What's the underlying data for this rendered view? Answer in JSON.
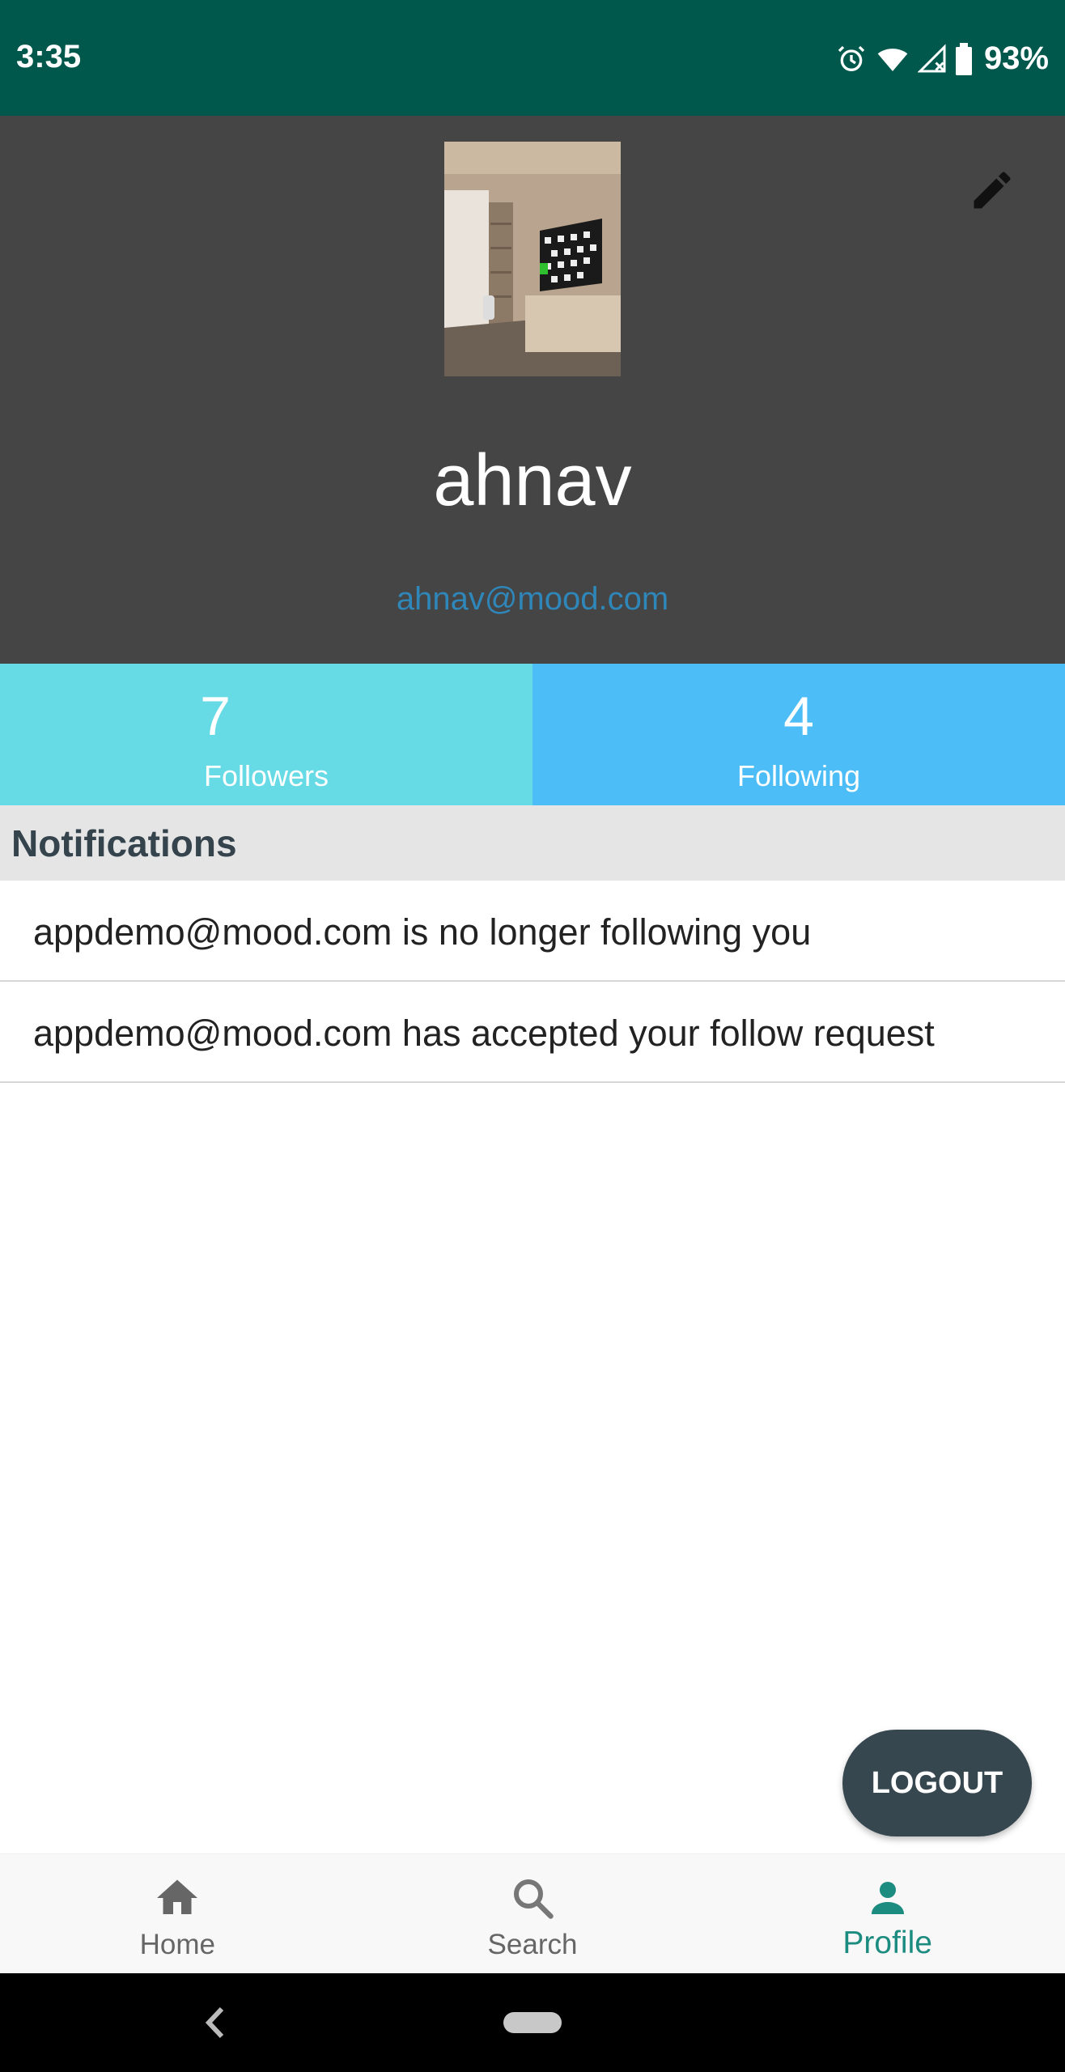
{
  "status_bar": {
    "time": "3:35",
    "battery": "93%",
    "icons": [
      "alarm-icon",
      "wifi-icon",
      "signal-icon",
      "battery-icon"
    ]
  },
  "profile": {
    "username": "ahnav",
    "email": "ahnav@mood.com",
    "avatar_icon": "profile-photo",
    "edit_icon": "pencil-icon"
  },
  "stats": {
    "followers_count": "7",
    "followers_label": "Followers",
    "following_count": "4",
    "following_label": "Following"
  },
  "notifications": {
    "title": "Notifications",
    "items": [
      {
        "text": "appdemo@mood.com is no longer following you"
      },
      {
        "text": "appdemo@mood.com has accepted your follow request"
      }
    ]
  },
  "logout_label": "LOGOUT",
  "bottom_nav": {
    "items": [
      {
        "label": "Home",
        "icon": "home-icon",
        "active": false
      },
      {
        "label": "Search",
        "icon": "search-icon",
        "active": false
      },
      {
        "label": "Profile",
        "icon": "person-icon",
        "active": true
      }
    ]
  },
  "colors": {
    "status_bar": "#00574b",
    "header_bg": "#454545",
    "followers_bg": "#66dbe5",
    "following_bg": "#4dbdf7",
    "accent": "#1c8b80",
    "logout_bg": "#37474f"
  }
}
